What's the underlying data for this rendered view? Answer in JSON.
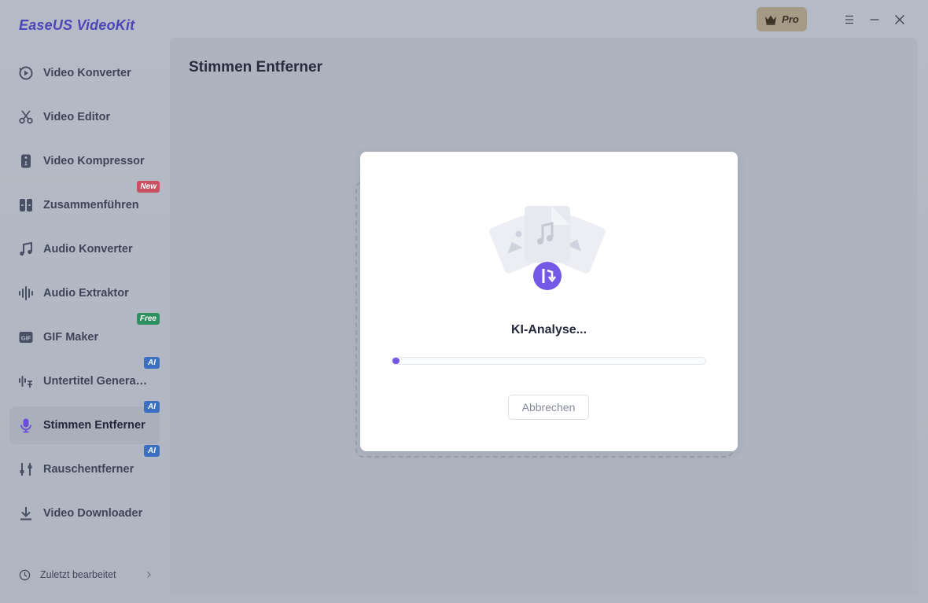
{
  "app": {
    "name": "EaseUS VideoKit",
    "pro_label": "Pro"
  },
  "sidebar": {
    "items": [
      {
        "label": "Video Konverter",
        "icon": "convert-icon"
      },
      {
        "label": "Video Editor",
        "icon": "scissors-icon"
      },
      {
        "label": "Video Kompressor",
        "icon": "compress-icon"
      },
      {
        "label": "Zusammenführen",
        "icon": "merge-icon",
        "badge": "New"
      },
      {
        "label": "Audio Konverter",
        "icon": "music-note-icon"
      },
      {
        "label": "Audio Extraktor",
        "icon": "waveform-icon"
      },
      {
        "label": "GIF Maker",
        "icon": "gif-icon",
        "badge": "Free"
      },
      {
        "label": "Untertitel Genera…",
        "icon": "subtitle-icon",
        "badge": "AI"
      },
      {
        "label": "Stimmen Entferner",
        "icon": "microphone-icon",
        "badge": "AI",
        "active": true
      },
      {
        "label": "Rauschentferner",
        "icon": "sliders-icon",
        "badge": "AI"
      },
      {
        "label": "Video Downloader",
        "icon": "download-icon"
      }
    ],
    "recent_label": "Zuletzt bearbeitet"
  },
  "main": {
    "title": "Stimmen Entferner"
  },
  "modal": {
    "status": "KI-Analyse...",
    "progress": 0.01,
    "cancel_label": "Abbrechen"
  },
  "colors": {
    "accent": "#7458e6",
    "logo": "#4d45b8",
    "badge_new": "#c75160",
    "badge_free": "#2f8f5e",
    "badge_ai": "#3d6fc0"
  }
}
